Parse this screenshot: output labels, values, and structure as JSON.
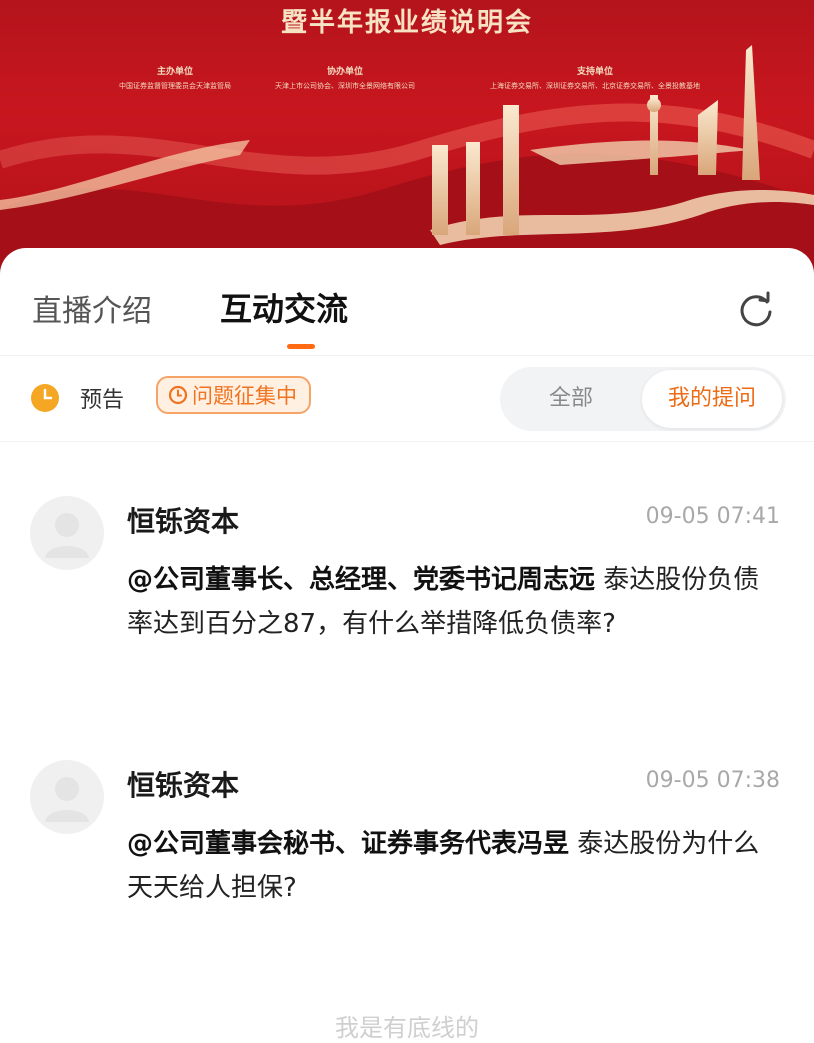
{
  "banner": {
    "title": "暨半年报业绩说明会",
    "organizers": [
      {
        "role": "主办单位",
        "names": "中国证券监督管理委员会天津监管局"
      },
      {
        "role": "协办单位",
        "names": "天津上市公司协会、深圳市全景网络有限公司"
      },
      {
        "role": "支持单位",
        "names": "上海证券交易所、深圳证券交易所、北京证券交易所、全景投教基地"
      }
    ]
  },
  "tabs": {
    "intro": "直播介绍",
    "interact": "互动交流",
    "active": "interact"
  },
  "status": {
    "preview": "预告",
    "badge": "问题征集中"
  },
  "filter": {
    "all": "全部",
    "mine": "我的提问",
    "selected": "mine"
  },
  "messages": [
    {
      "author": "恒铄资本",
      "time": "09-05 07:41",
      "mention": "@公司董事长、总经理、党委书记周志远",
      "text": " 泰达股份负债率达到百分之87，有什么举措降低负债率?"
    },
    {
      "author": "恒铄资本",
      "time": "09-05 07:38",
      "mention": "@公司董事会秘书、证券事务代表冯昱",
      "text": " 泰达股份为什么天天给人担保?"
    }
  ],
  "footer": "我是有底线的",
  "colors": {
    "accent": "#ff6a13",
    "banner_red": "#c8161f",
    "badge_bg": "#fff0e2",
    "clock": "#f5a623"
  },
  "icons": {
    "refresh": "refresh-icon",
    "clock": "clock-icon",
    "badge": "clock-icon",
    "avatar": "user-avatar-icon"
  }
}
